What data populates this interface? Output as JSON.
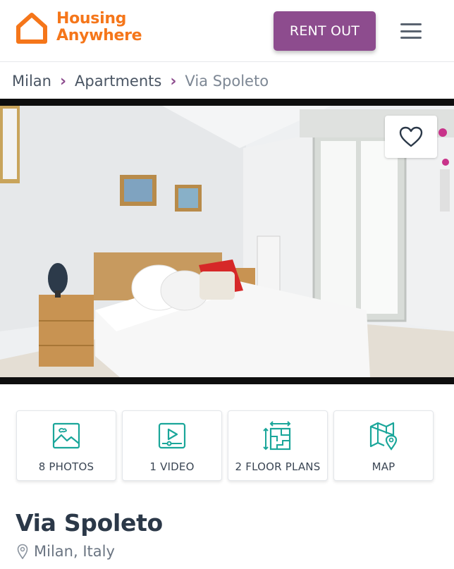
{
  "header": {
    "logo_line1": "Housing",
    "logo_line2": "Anywhere",
    "rent_out_label": "RENT OUT",
    "brand_color": "#f5761a",
    "accent_color": "#8d4c8e"
  },
  "breadcrumb": {
    "items": [
      "Milan",
      "Apartments",
      "Via Spoleto"
    ]
  },
  "media_tiles": [
    {
      "icon": "photos-icon",
      "label": "8 PHOTOS"
    },
    {
      "icon": "video-icon",
      "label": "1 VIDEO"
    },
    {
      "icon": "floor-plan-icon",
      "label": "2 FLOOR PLANS"
    },
    {
      "icon": "map-icon",
      "label": "MAP"
    }
  ],
  "listing": {
    "title": "Via Spoleto",
    "location": "Milan, Italy"
  },
  "icon_color": "#1aa69a"
}
